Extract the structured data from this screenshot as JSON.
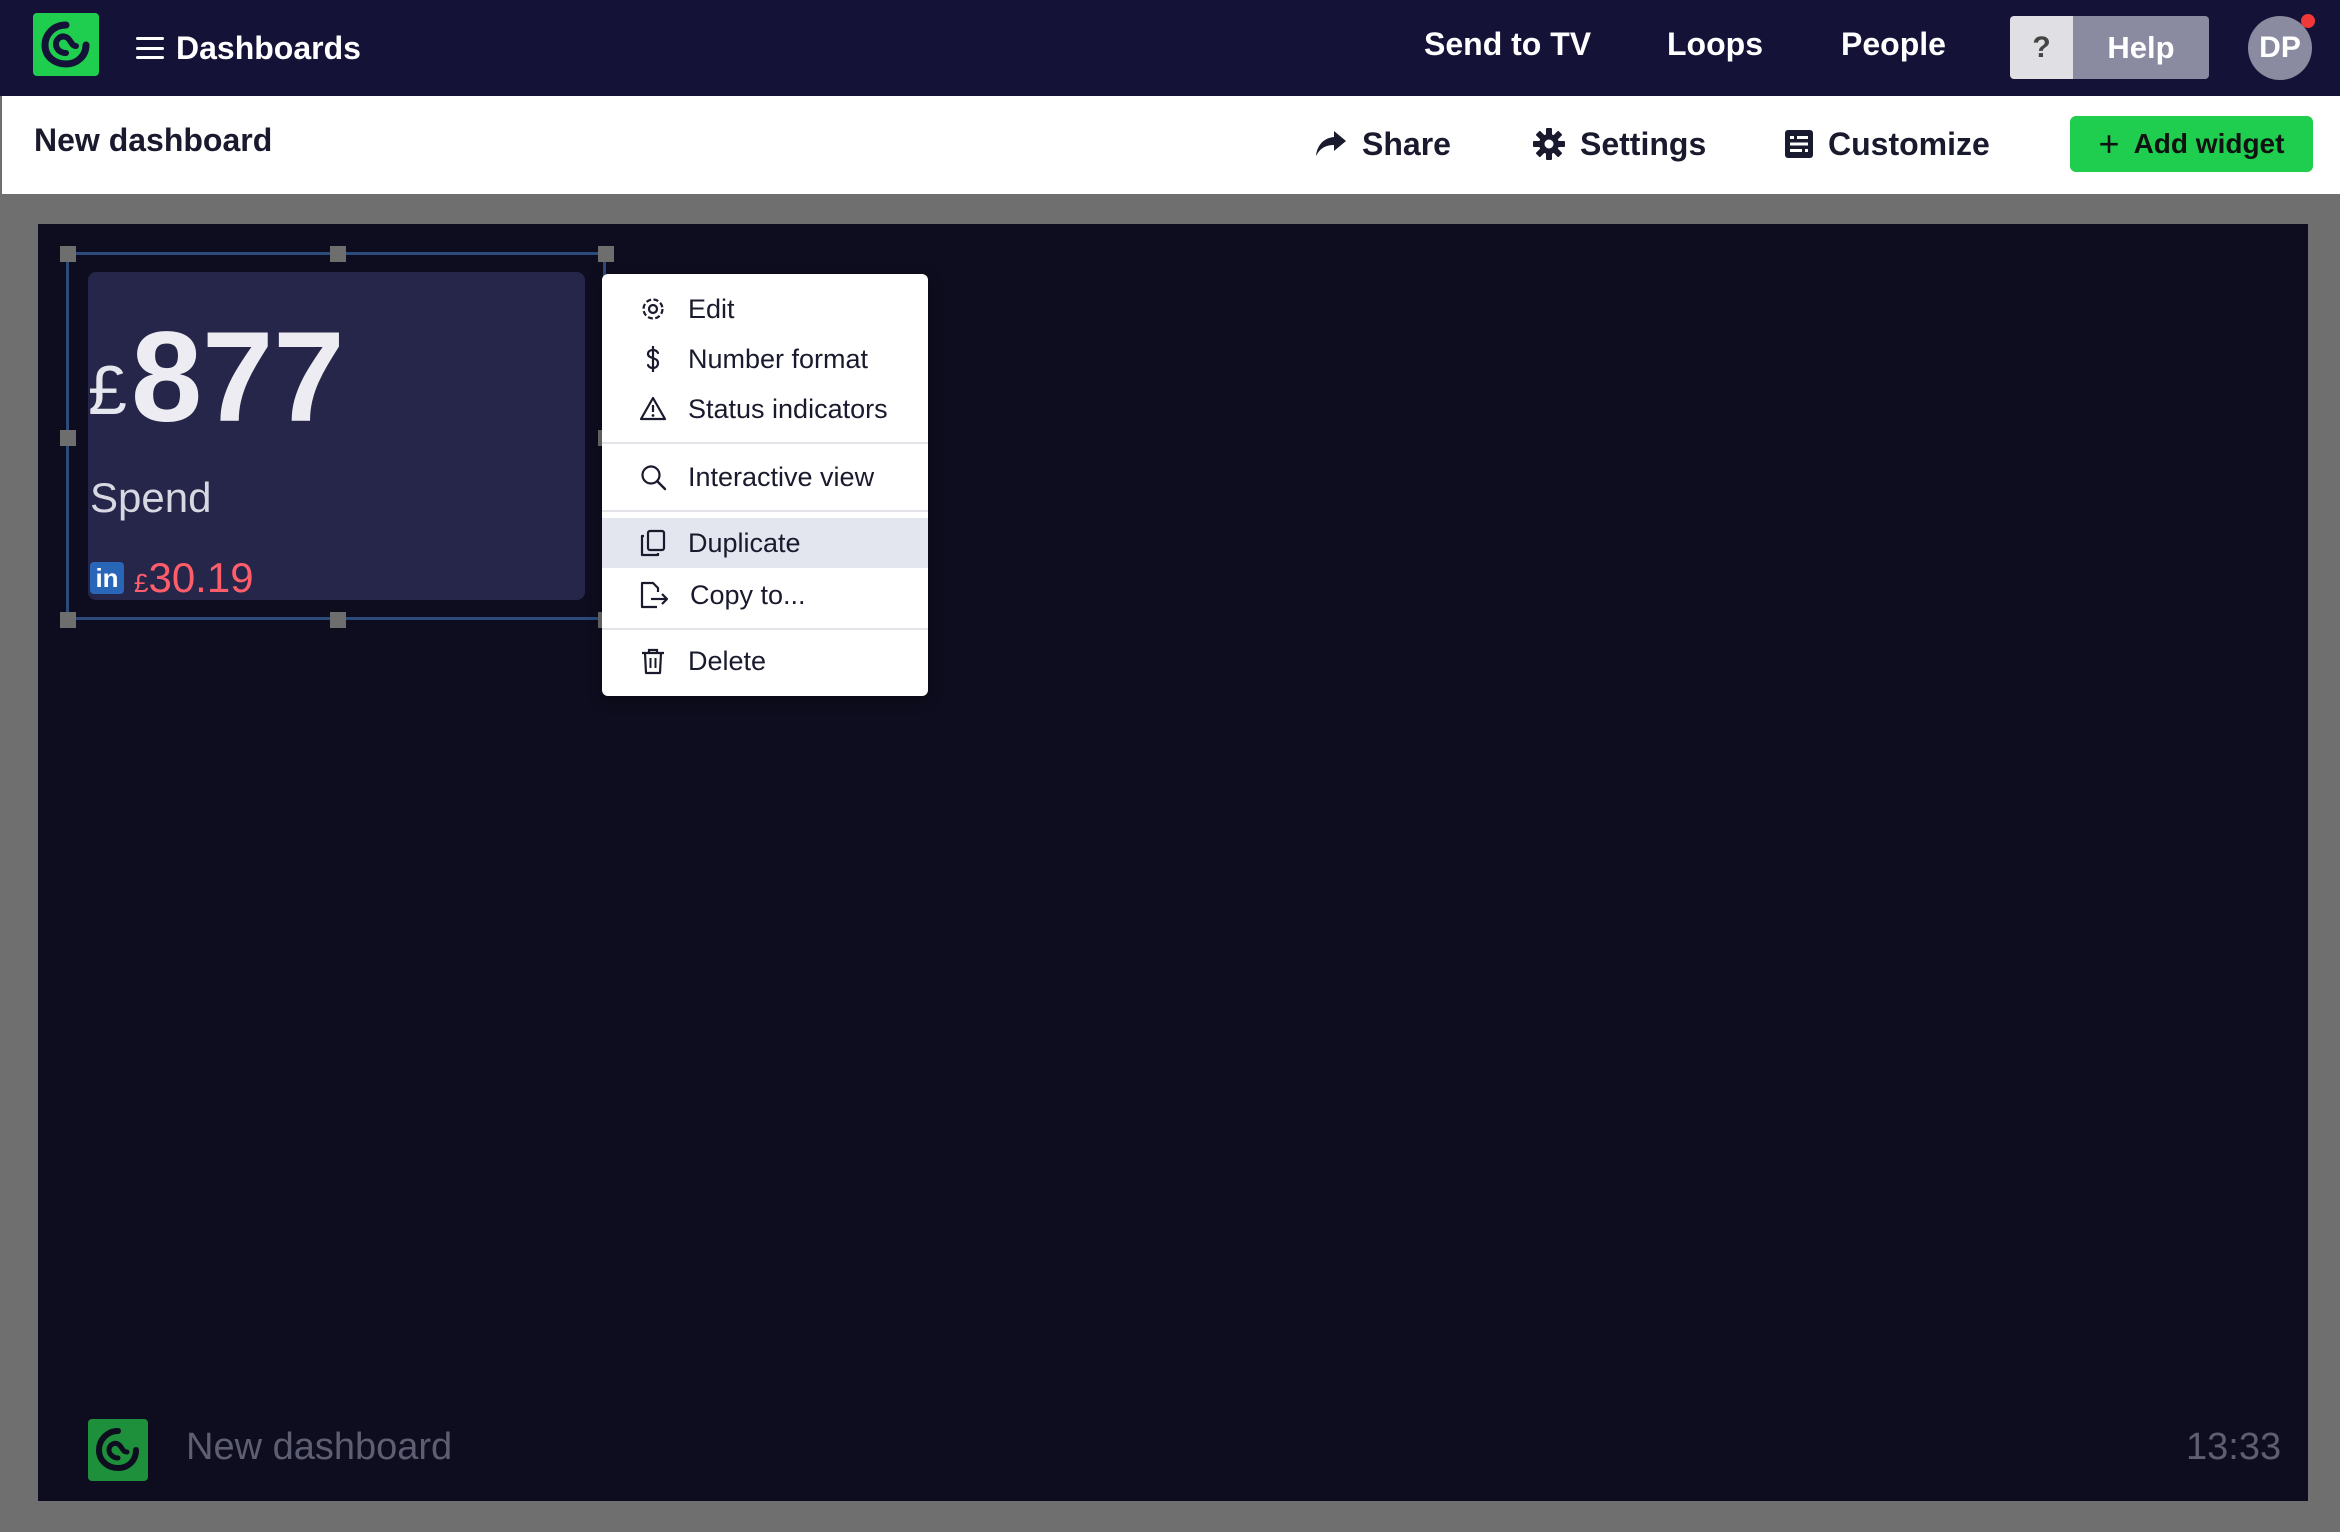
{
  "app": {
    "brand_color": "#1fce4f",
    "nav_bg": "#151238",
    "canvas_bg": "#0e0d1f"
  },
  "topbar": {
    "menu_label": "Dashboards",
    "nav": [
      "Send to TV",
      "Loops",
      "People"
    ],
    "help_q": "?",
    "help_label": "Help",
    "avatar_initials": "DP"
  },
  "toolbar": {
    "title": "New dashboard",
    "share": "Share",
    "settings": "Settings",
    "customize": "Customize",
    "add_widget": "Add widget",
    "add_widget_icon": "+"
  },
  "widget": {
    "currency": "£",
    "value": "877",
    "label": "Spend",
    "source_icon": "in",
    "delta_currency": "£",
    "delta_value": "30.19",
    "delta_color": "#ff5d6a"
  },
  "context_menu": {
    "items": [
      {
        "label": "Edit",
        "icon": "gear-icon"
      },
      {
        "label": "Number format",
        "icon": "dollar-icon"
      },
      {
        "label": "Status indicators",
        "icon": "warning-icon"
      },
      {
        "label": "Interactive view",
        "icon": "search-icon"
      },
      {
        "label": "Duplicate",
        "icon": "copy-icon"
      },
      {
        "label": "Copy to...",
        "icon": "export-file-icon"
      },
      {
        "label": "Delete",
        "icon": "trash-icon"
      }
    ]
  },
  "footer": {
    "title": "New dashboard",
    "clock": "13:33"
  }
}
